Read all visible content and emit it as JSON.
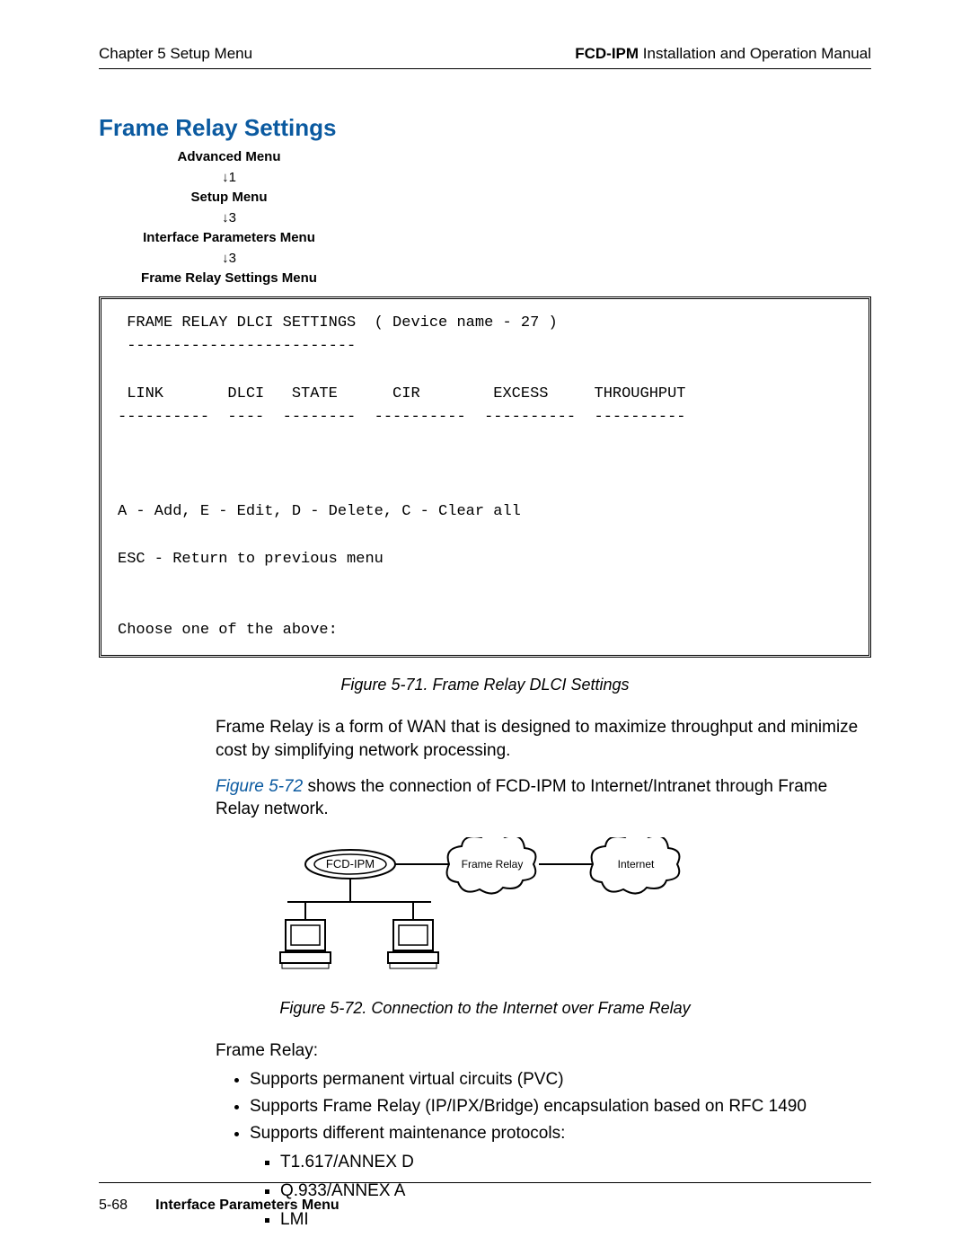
{
  "header": {
    "left": "Chapter 5  Setup Menu",
    "right_bold": "FCD-IPM",
    "right_rest": " Installation and Operation Manual"
  },
  "title": "Frame Relay Settings",
  "breadcrumb": {
    "l1": "Advanced Menu",
    "a1": "↓1",
    "l2": "Setup Menu",
    "a2": "↓3",
    "l3": "Interface Parameters Menu",
    "a3": "↓3",
    "l4": "Frame Relay Settings Menu"
  },
  "terminal": {
    "title": " FRAME RELAY DLCI SETTINGS  ( Device name - 27 )",
    "dash1": " -------------------------",
    "cols": " LINK       DLCI   STATE      CIR        EXCESS     THROUGHPUT",
    "dash2": "----------  ----  --------  ----------  ----------  ----------",
    "blank": "",
    "cmds": "A - Add, E - Edit, D - Delete, C - Clear all",
    "esc": "ESC - Return to previous menu",
    "prompt": "Choose one of the above:"
  },
  "figcap1": "Figure 5-71.  Frame Relay DLCI Settings",
  "para1": "Frame Relay is a form of WAN that is designed to maximize throughput and minimize cost by simplifying network processing.",
  "para2_pre": "",
  "para2_link": "Figure 5-72",
  "para2_post": " shows the connection of FCD-IPM to Internet/Intranet through Frame Relay network.",
  "diagram": {
    "node1": "FCD-IPM",
    "node2": "Frame Relay",
    "node3": "Internet"
  },
  "figcap2": "Figure 5-72.  Connection to the Internet over Frame Relay",
  "list_intro": "Frame Relay:",
  "bullets": [
    "Supports permanent virtual circuits (PVC)",
    "Supports Frame Relay (IP/IPX/Bridge) encapsulation based on RFC 1490",
    "Supports different maintenance protocols:"
  ],
  "sub_bullets": [
    "T1.617/ANNEX D",
    "Q.933/ANNEX A",
    "LMI"
  ],
  "footer": {
    "pageno": "5-68",
    "section": "Interface Parameters Menu"
  }
}
